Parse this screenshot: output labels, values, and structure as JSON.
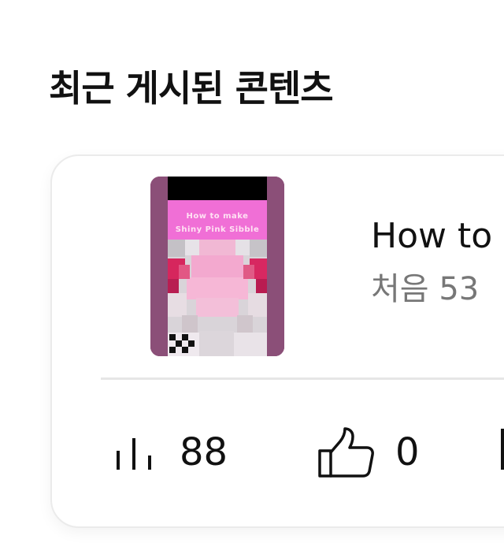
{
  "section": {
    "title": "최근 게시된 콘텐츠"
  },
  "content_card": {
    "thumbnail": {
      "overlay_line1": "How to make",
      "overlay_line2": "Shiny Pink Sibble"
    },
    "title": "How to",
    "subtitle": "처음 53",
    "stats": {
      "views": "88",
      "likes": "0",
      "views_icon": "bar-chart-icon",
      "likes_icon": "thumbs-up-icon"
    }
  }
}
